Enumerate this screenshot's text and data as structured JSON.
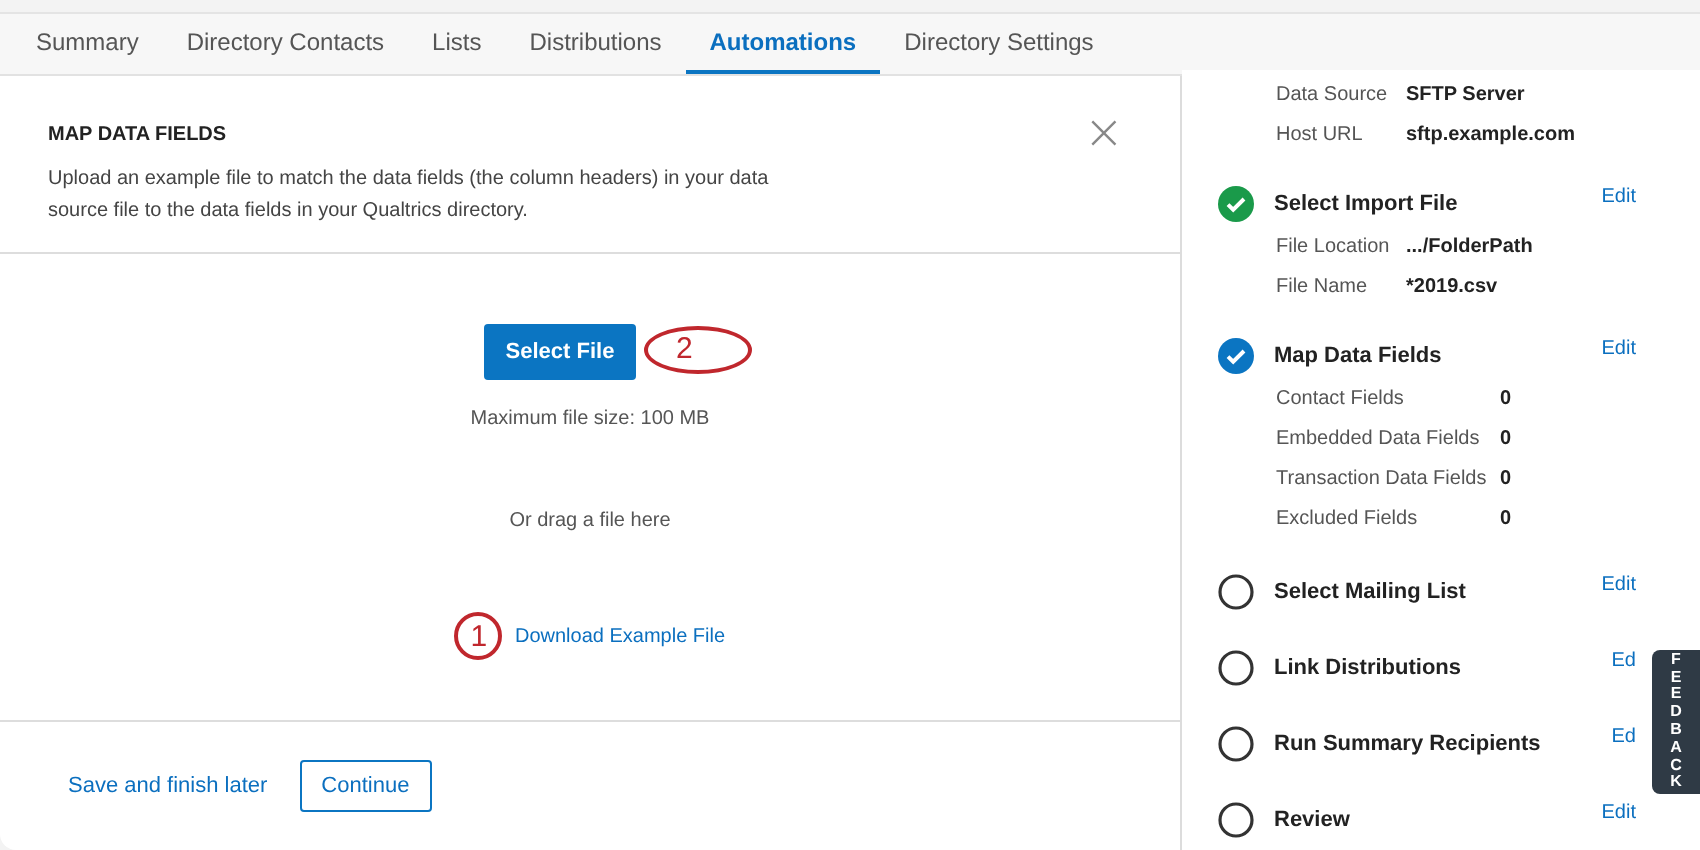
{
  "tabs": [
    {
      "label": "Summary",
      "selected": false
    },
    {
      "label": "Directory Contacts",
      "selected": false
    },
    {
      "label": "Lists",
      "selected": false
    },
    {
      "label": "Distributions",
      "selected": false
    },
    {
      "label": "Automations",
      "selected": true
    },
    {
      "label": "Directory Settings",
      "selected": false
    }
  ],
  "panel": {
    "title": "MAP DATA FIELDS",
    "description": "Upload an example file to match the data fields (the column headers) in your data source file to the data fields in your Qualtrics directory.",
    "close": "×",
    "select_button": {
      "label": "Select File",
      "callout": "2"
    },
    "max_size": "Maximum file size: 100 MB",
    "drag_hint": "Or drag a file here",
    "download_link": {
      "label": "Download Example File",
      "callout": "1"
    },
    "footer": {
      "save_link": "Save and finish later",
      "continue_button": "Continue"
    }
  },
  "summary": {
    "top_details": [
      {
        "label": "Data Source",
        "value": "SFTP Server"
      },
      {
        "label": "Host URL",
        "value": "sftp.example.com"
      }
    ],
    "steps": [
      {
        "title": "Select Import File",
        "kind": "done",
        "edit": "Edit",
        "details": [
          {
            "label": "File Location",
            "value": ".../FolderPath"
          },
          {
            "label": "File Name",
            "value": "*2019.csv"
          }
        ]
      },
      {
        "title": "Map Data Fields",
        "kind": "current",
        "edit": "Edit",
        "details": [
          {
            "label": "Contact Fields",
            "value": "0"
          },
          {
            "label": "Embedded Data Fields",
            "value": "0"
          },
          {
            "label": "Transaction Data Fields",
            "value": "0"
          },
          {
            "label": "Excluded Fields",
            "value": "0"
          }
        ]
      },
      {
        "title": "Select Mailing List",
        "kind": "pending",
        "edit": "Edit"
      },
      {
        "title": "Link Distributions",
        "kind": "pending",
        "edit": "Ed"
      },
      {
        "title": "Run Summary Recipients",
        "kind": "pending",
        "edit": "Ed"
      },
      {
        "title": "Review",
        "kind": "pending",
        "edit": "Edit"
      }
    ]
  },
  "feedback_tab": "FEEDBACK"
}
